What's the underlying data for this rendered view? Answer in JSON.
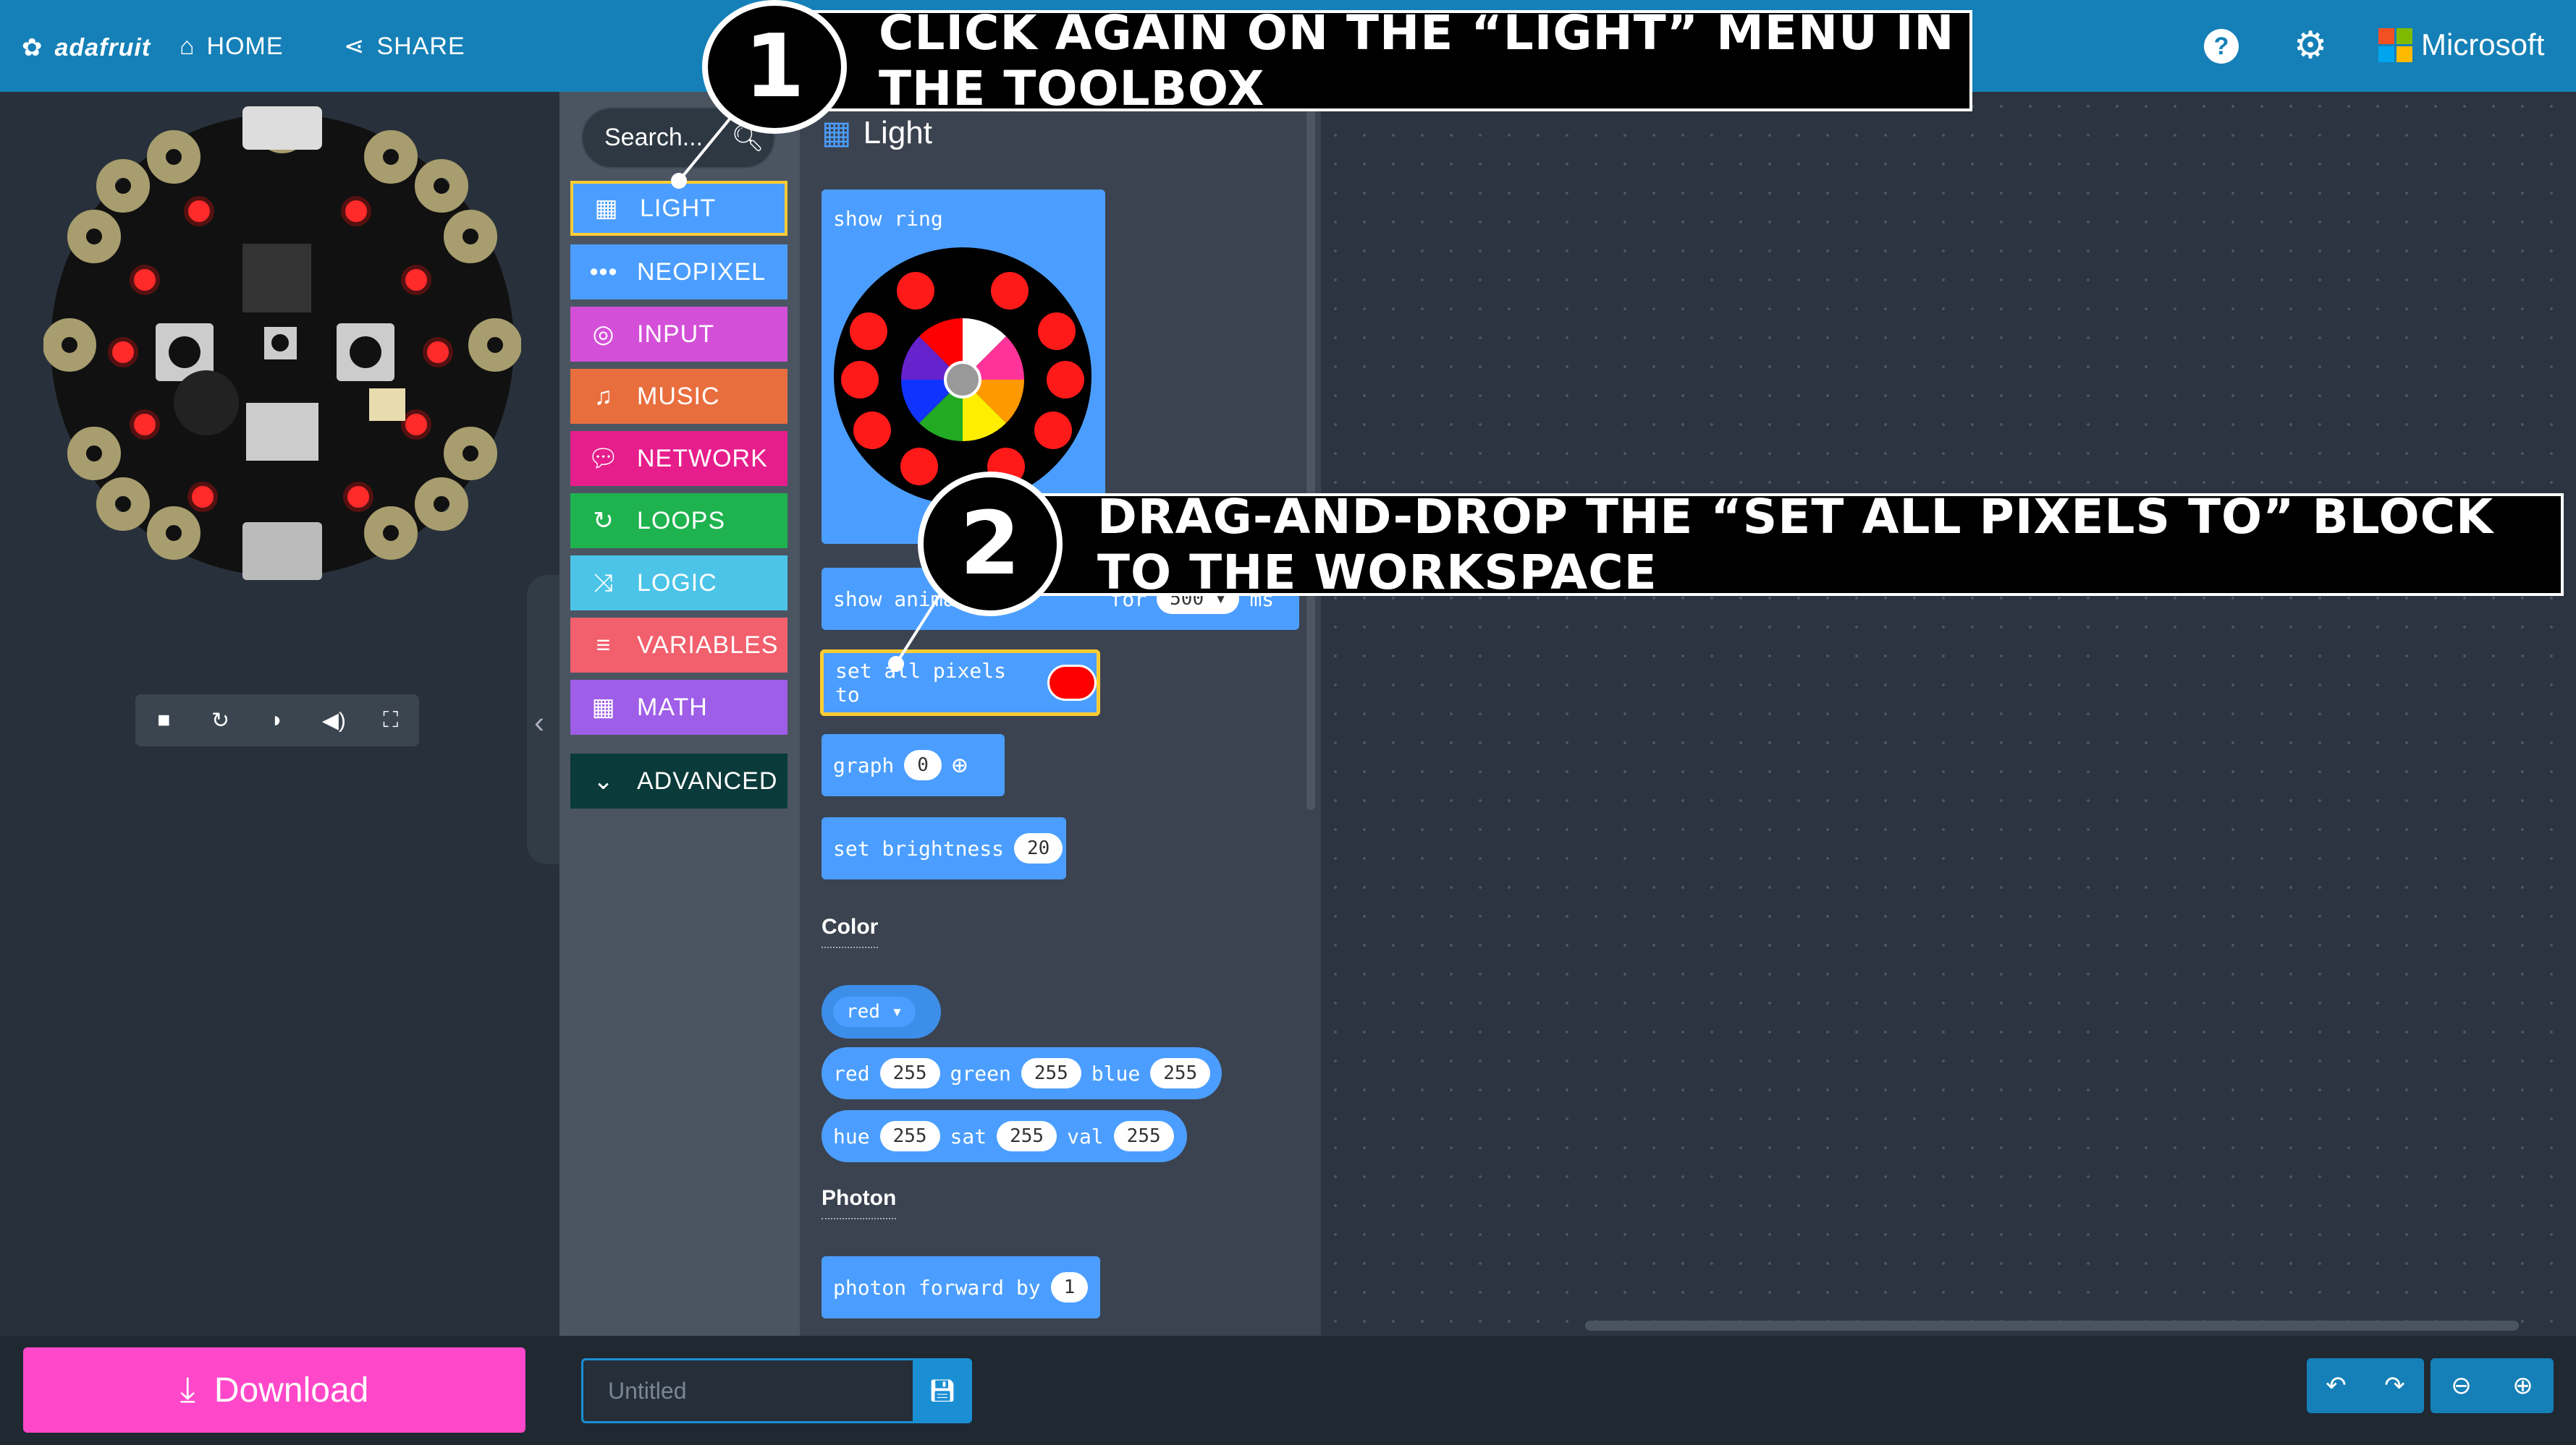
{
  "header": {
    "logo_text": "adafruit",
    "home_label": "HOME",
    "share_label": "SHARE",
    "microsoft_label": "Microsoft"
  },
  "toolbox": {
    "search_placeholder": "Search...",
    "categories": [
      {
        "label": "LIGHT",
        "color": "#4b9eff",
        "icon": "grid-icon"
      },
      {
        "label": "NEOPIXEL",
        "color": "#4b9eff",
        "icon": "dots-icon"
      },
      {
        "label": "INPUT",
        "color": "#d44fd8",
        "icon": "target-icon"
      },
      {
        "label": "MUSIC",
        "color": "#e96e3e",
        "icon": "headphones-icon"
      },
      {
        "label": "NETWORK",
        "color": "#e61e8c",
        "icon": "chat-icon"
      },
      {
        "label": "LOOPS",
        "color": "#1fb34f",
        "icon": "refresh-icon"
      },
      {
        "label": "LOGIC",
        "color": "#4bc4e8",
        "icon": "shuffle-icon"
      },
      {
        "label": "VARIABLES",
        "color": "#f25f6d",
        "icon": "list-icon"
      },
      {
        "label": "MATH",
        "color": "#9f5ee8",
        "icon": "calculator-icon"
      },
      {
        "label": "ADVANCED",
        "color": "#0a3a3a",
        "icon": "chevron-down-icon"
      }
    ]
  },
  "flyout": {
    "title": "Light",
    "blocks": {
      "show_ring": "show ring",
      "show_animation": "show anima",
      "show_animation_for": "for",
      "show_animation_ms": "500 ▾",
      "show_animation_unit": "ms",
      "set_all_pixels": "set all pixels to",
      "graph": "graph",
      "graph_value": "0",
      "set_brightness": "set brightness",
      "brightness_value": "20"
    },
    "color_section": {
      "label": "Color",
      "red_dropdown": "red ▾",
      "rgb": {
        "red_label": "red",
        "red": "255",
        "green_label": "green",
        "green": "255",
        "blue_label": "blue",
        "blue": "255"
      },
      "hsv": {
        "hue_label": "hue",
        "hue": "255",
        "sat_label": "sat",
        "sat": "255",
        "val_label": "val",
        "val": "255"
      }
    },
    "photon_section": {
      "label": "Photon",
      "forward": "photon forward by",
      "forward_value": "1"
    }
  },
  "bottom_bar": {
    "download_label": "Download",
    "project_name_placeholder": "Untitled"
  },
  "callouts": {
    "step1_number": "1",
    "step1_text": "Click again on the “Light” menu in the toolbox",
    "step2_number": "2",
    "step2_text": "Drag-and-drop the “set all pixels to” block to the workspace"
  },
  "colors": {
    "header_blue": "#1580b7",
    "block_blue": "#4b9eff",
    "download_pink": "#ff48c9",
    "highlight_yellow": "#ffcc33",
    "led_red": "#ff1a1a"
  }
}
